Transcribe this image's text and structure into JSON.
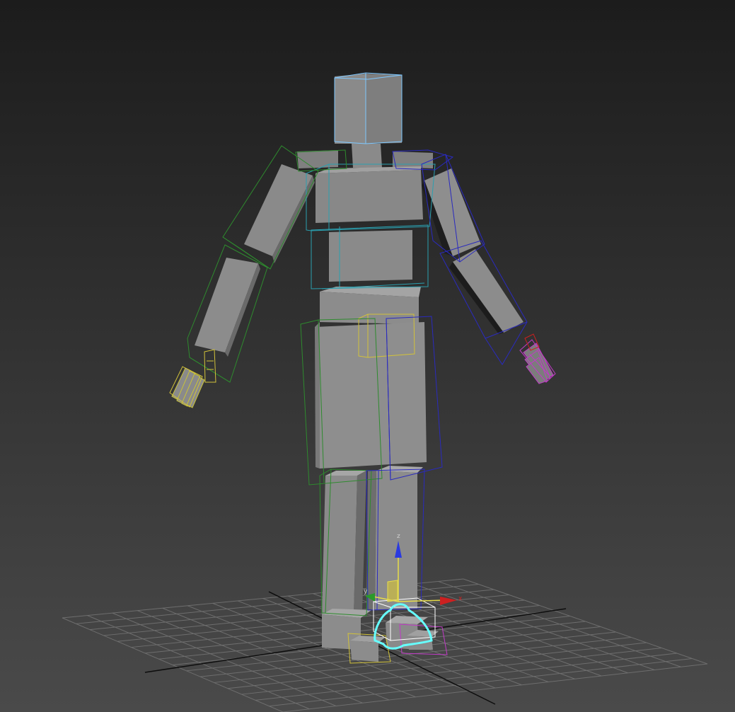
{
  "viewport": {
    "background_top": "#1c1c1c",
    "background_bottom": "#4a4a4a",
    "grid_color": "#6e6e6e",
    "grid_axis_color": "#0d0d0d"
  },
  "gizmo": {
    "x_label": "x",
    "y_label": "y",
    "z_label": "z",
    "x_color": "#cc2020",
    "y_color": "#2a9a2a",
    "z_color": "#2a3ae0"
  },
  "colors": {
    "mesh_face": "#8c8c8c",
    "mesh_side": "#6a6a6a",
    "mesh_top": "#a8a8a8",
    "bone_green": "#2e8b2e",
    "bone_blue": "#2a2abf",
    "bone_teal": "#2aa0b0",
    "bone_yellow": "#d2c23a",
    "bone_magenta": "#c23ac8",
    "selected_cyan": "#66ffff",
    "selected_white": "#ffffff"
  }
}
